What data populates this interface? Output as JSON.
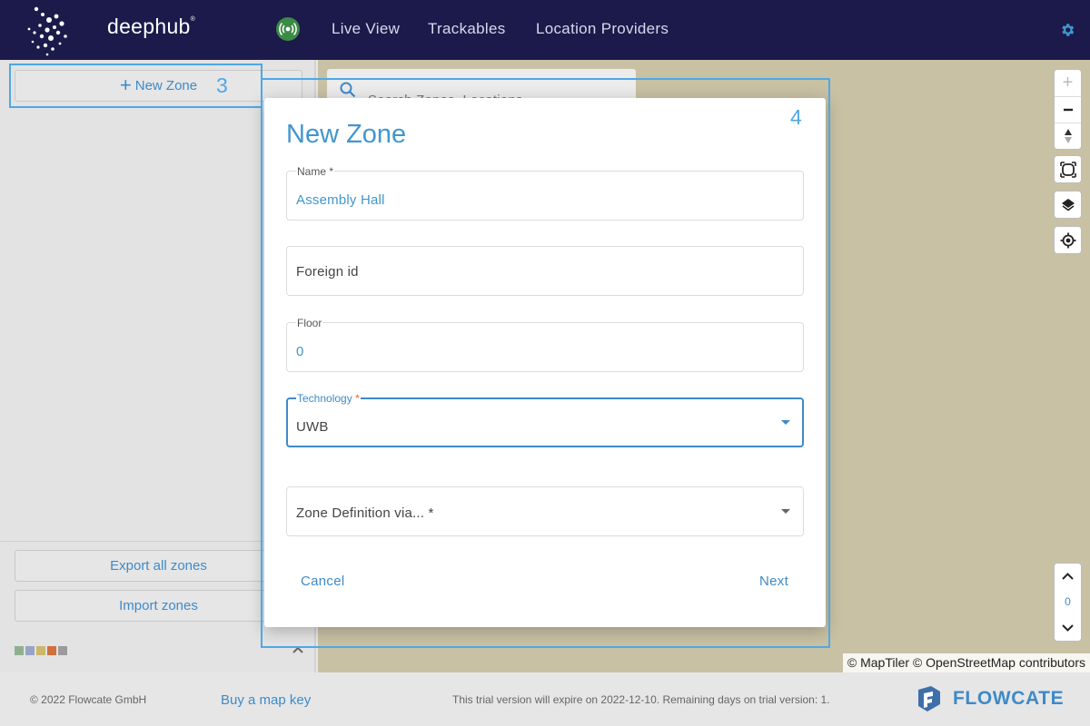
{
  "header": {
    "logo_text": "deephub",
    "logo_mark": "®",
    "nav": [
      "Live View",
      "Trackables",
      "Location Providers"
    ],
    "status_icon": "broadcast-icon",
    "settings_icon": "gear-icon"
  },
  "sidebar": {
    "new_zone_label": "New Zone",
    "export_label": "Export all zones",
    "import_label": "Import zones",
    "swatch_colors": [
      "#8fb08f",
      "#9aa3c7",
      "#cdb76a",
      "#d0703a",
      "#9b9b9b"
    ]
  },
  "map": {
    "search_placeholder": "Search Zones, Locations",
    "floor_value": "0",
    "attribution": "© MapTiler © OpenStreetMap contributors"
  },
  "dialog": {
    "title": "New Zone",
    "fields": {
      "name": {
        "label": "Name *",
        "value": "Assembly Hall"
      },
      "foreign_id": {
        "placeholder": "Foreign id"
      },
      "floor": {
        "label": "Floor",
        "value": "0"
      },
      "technology": {
        "label": "Technology",
        "required_mark": "*",
        "value": "UWB"
      },
      "zone_definition": {
        "placeholder": "Zone Definition via... *"
      }
    },
    "cancel_label": "Cancel",
    "next_label": "Next"
  },
  "annotations": [
    "3",
    "4"
  ],
  "footer": {
    "copyright": "© 2022 Flowcate GmbH",
    "buy_key": "Buy a map key",
    "trial": "This trial version will expire on 2022-12-10. Remaining days on trial version: 1.",
    "brand": "FLOWCATE"
  },
  "colors": {
    "header_bg": "#1b1a4a",
    "accent": "#3e8ac8",
    "annotation": "#4ea8e6"
  }
}
